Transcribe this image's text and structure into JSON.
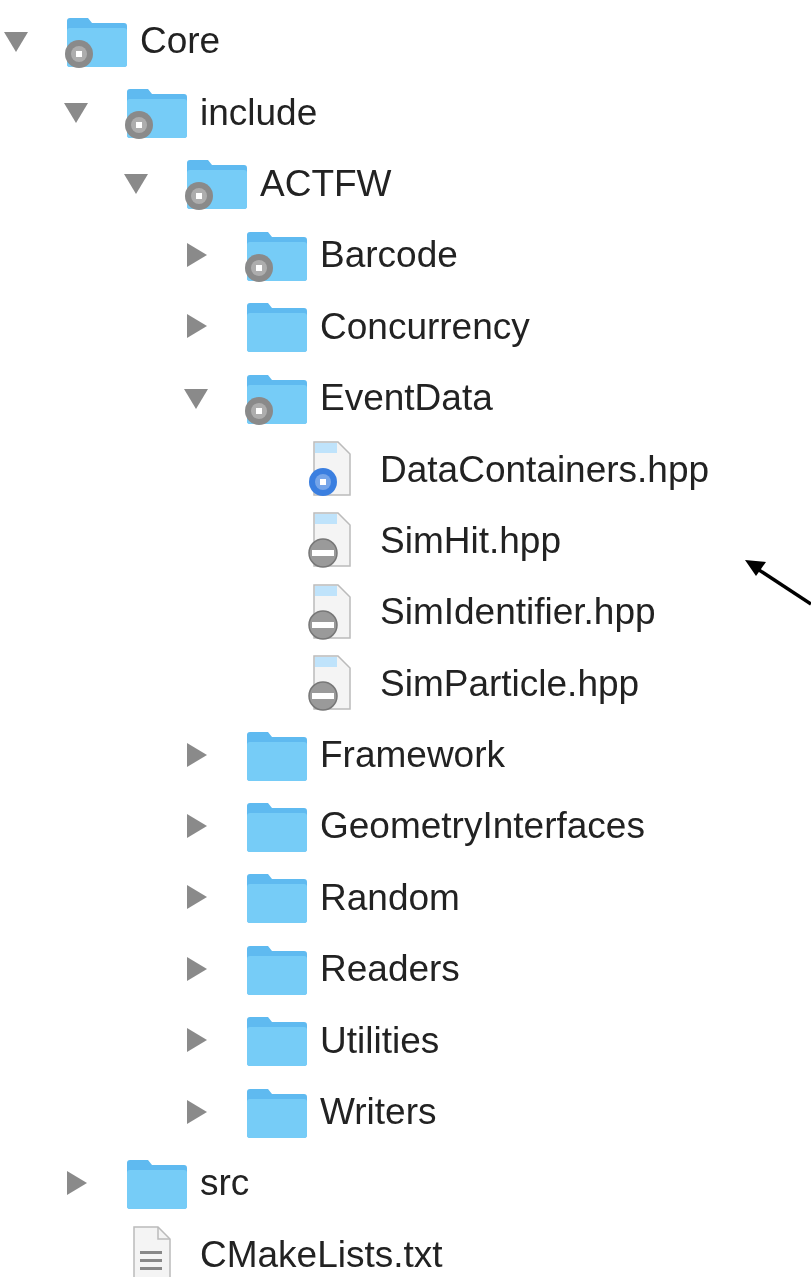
{
  "tree": [
    {
      "kind": "folder",
      "name": "Core",
      "badge": {
        "kind": "disc",
        "color": "#8a8a8a"
      },
      "expanded": true,
      "children": [
        {
          "kind": "folder",
          "name": "include",
          "badge": {
            "kind": "disc",
            "color": "#8a8a8a"
          },
          "expanded": true,
          "children": [
            {
              "kind": "folder",
              "name": "ACTFW",
              "badge": {
                "kind": "disc",
                "color": "#8a8a8a"
              },
              "expanded": true,
              "children": [
                {
                  "kind": "folder",
                  "name": "Barcode",
                  "badge": {
                    "kind": "disc",
                    "color": "#8a8a8a"
                  },
                  "expanded": false
                },
                {
                  "kind": "folder",
                  "name": "Concurrency",
                  "expanded": false
                },
                {
                  "kind": "folder",
                  "name": "EventData",
                  "badge": {
                    "kind": "disc",
                    "color": "#8a8a8a"
                  },
                  "expanded": true,
                  "children": [
                    {
                      "kind": "source",
                      "name": "DataContainers.hpp",
                      "badge": {
                        "kind": "disc",
                        "color": "#3b7fe0"
                      }
                    },
                    {
                      "kind": "source",
                      "name": "SimHit.hpp",
                      "badge": {
                        "kind": "minus"
                      }
                    },
                    {
                      "kind": "source",
                      "name": "SimIdentifier.hpp",
                      "badge": {
                        "kind": "minus"
                      }
                    },
                    {
                      "kind": "source",
                      "name": "SimParticle.hpp",
                      "badge": {
                        "kind": "minus"
                      }
                    }
                  ]
                },
                {
                  "kind": "folder",
                  "name": "Framework",
                  "expanded": false
                },
                {
                  "kind": "folder",
                  "name": "GeometryInterfaces",
                  "expanded": false
                },
                {
                  "kind": "folder",
                  "name": "Random",
                  "expanded": false
                },
                {
                  "kind": "folder",
                  "name": "Readers",
                  "expanded": false
                },
                {
                  "kind": "folder",
                  "name": "Utilities",
                  "expanded": false
                },
                {
                  "kind": "folder",
                  "name": "Writers",
                  "expanded": false
                }
              ]
            }
          ]
        },
        {
          "kind": "folder",
          "name": "src",
          "expanded": false
        },
        {
          "kind": "text",
          "name": "CMakeLists.txt"
        }
      ]
    }
  ],
  "annotation": {
    "kind": "arrow"
  }
}
